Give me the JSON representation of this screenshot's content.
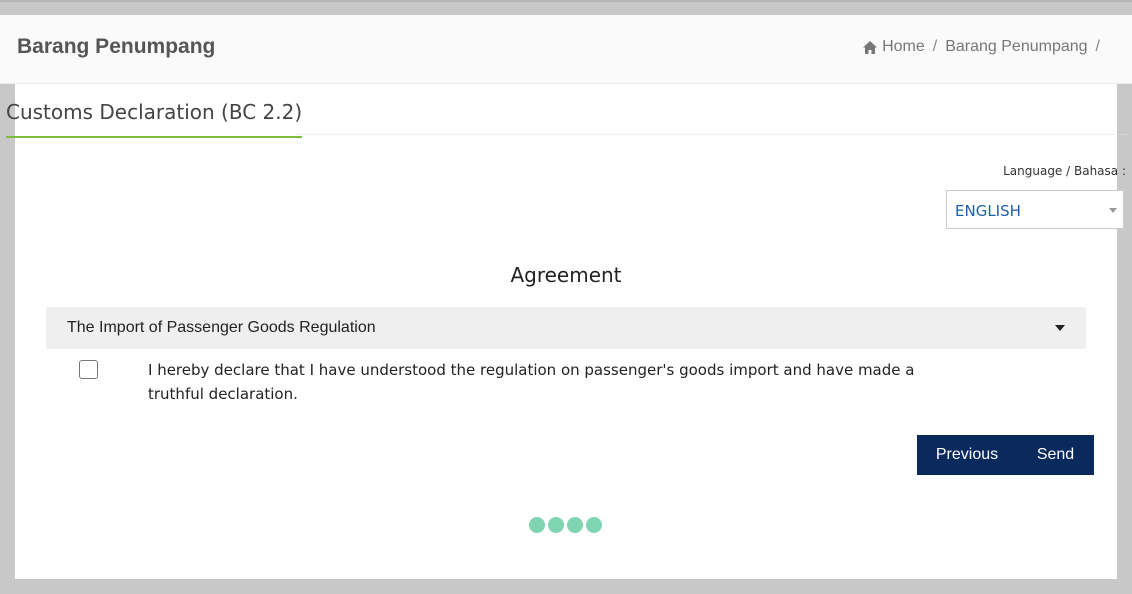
{
  "header": {
    "title": "Barang Penumpang",
    "breadcrumb": [
      "Home",
      "Barang Penumpang"
    ],
    "breadcrumb_separator": "/"
  },
  "section": {
    "tab_label": "Customs Declaration (BC 2.2)"
  },
  "language": {
    "label": "Language / Bahasa :",
    "selected": "ENGLISH"
  },
  "agreement": {
    "title": "Agreement",
    "accordion_label": "The Import of Passenger Goods Regulation",
    "declaration_text": "I hereby declare that I have understood the regulation on passenger's goods import and have made a truthful declaration.",
    "checked": false
  },
  "actions": {
    "previous_label": "Previous",
    "send_label": "Send"
  },
  "colors": {
    "accent_green": "#7cbd3c",
    "button_navy": "#0a2a5e",
    "loader_mint": "#7fd5b2",
    "link_blue": "#1e5fa8"
  },
  "icons": {
    "home": "home-icon",
    "dropdown": "chevron-down-icon"
  }
}
